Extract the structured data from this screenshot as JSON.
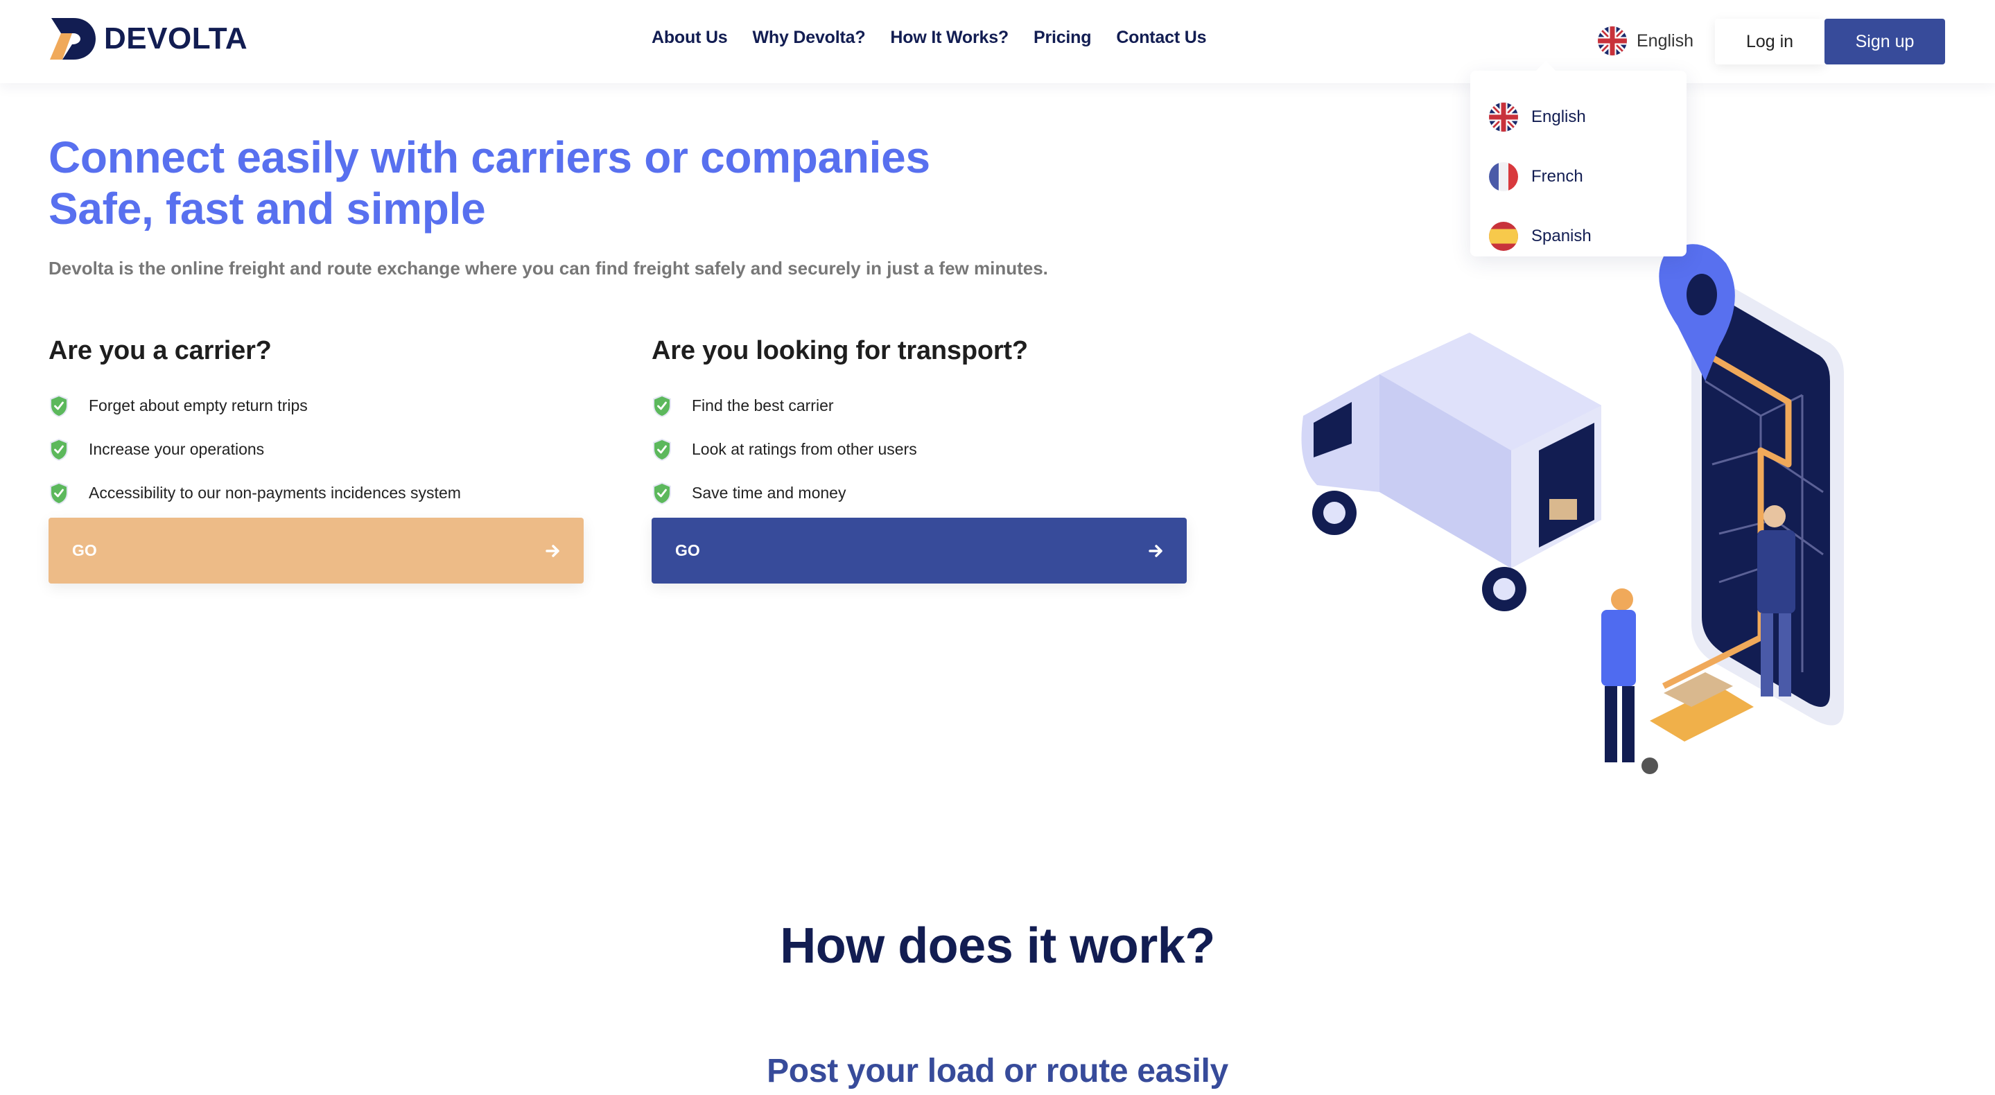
{
  "brand": {
    "name": "DEVOLTA",
    "logo_icon": "devolta-d-logo"
  },
  "nav": {
    "items": [
      "About Us",
      "Why Devolta?",
      "How It Works?",
      "Pricing",
      "Contact Us"
    ]
  },
  "language": {
    "current": "English",
    "current_flag_icon": "uk-flag-icon",
    "options": [
      {
        "label": "English",
        "flag_icon": "uk-flag-icon"
      },
      {
        "label": "French",
        "flag_icon": "france-flag-icon"
      },
      {
        "label": "Spanish",
        "flag_icon": "spain-flag-icon"
      }
    ]
  },
  "auth": {
    "login_label": "Log in",
    "signup_label": "Sign up"
  },
  "hero": {
    "title_line1": "Connect easily with carriers or companies",
    "title_line2": "Safe, fast and simple",
    "subtitle": "Devolta is the online freight and route exchange where you can find freight safely and securely in just a few minutes."
  },
  "carrier": {
    "heading": "Are you a carrier?",
    "features": [
      "Forget about empty return trips",
      "Increase your operations",
      "Accessibility to our non-payments incidences system"
    ],
    "button_label": "GO",
    "button_color": "#edbb87"
  },
  "shipper": {
    "heading": "Are you looking for transport?",
    "features": [
      "Find the best carrier",
      "Look at ratings from other users",
      "Save time and money"
    ],
    "button_label": "GO",
    "button_color": "#374b9a"
  },
  "illustration": {
    "description": "Isometric delivery truck, smartphone map with location pin, worker with pallet jack, businessman"
  },
  "how_it_works": {
    "title": "How does it work?",
    "subtitle": "Post your load or route easily"
  },
  "colors": {
    "primary_navy": "#121d52",
    "accent_blue": "#5870ef",
    "button_blue": "#374b9a",
    "button_orange": "#edbb87",
    "check_green": "#5cb85c"
  }
}
